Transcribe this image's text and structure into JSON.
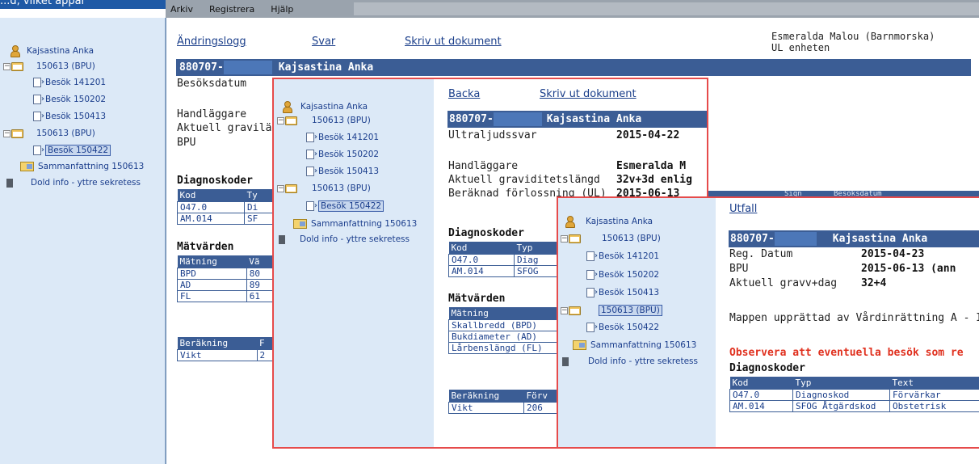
{
  "top_strip_text": "...d, vilket appar",
  "menu": {
    "items": [
      "Arkiv",
      "Registrera",
      "Hjälp"
    ]
  },
  "user": {
    "name": "Esmeralda Malou (Barnmorska)",
    "unit": "UL enheten"
  },
  "tree": {
    "patient": "Kajsastina Anka",
    "folder1": "150613 (BPU)",
    "visits1": [
      "Besök 141201",
      "Besök 150202",
      "Besök 150413"
    ],
    "folder2": "150613 (BPU)",
    "visit_selected": "Besök 150422",
    "summary": "Sammanfattning 150613",
    "hidden": "Dold info - yttre sekretess"
  },
  "base": {
    "links": [
      "Ändringslogg",
      "Svar",
      "Skriv ut dokument"
    ],
    "header_id": "880707-",
    "header_name": "Kajsastina Anka",
    "besoksdatum": "Besöksdatum",
    "handlaggare": "Handläggare",
    "aktuell": "Aktuell graviläng",
    "bpu": "BPU",
    "diag_title": "Diagnoskoder",
    "diag_headers": [
      "Kod",
      "Ty"
    ],
    "diag_rows": [
      [
        "O47.0",
        "Di"
      ],
      [
        "AM.014",
        "SF"
      ]
    ],
    "mat_title": "Mätvärden",
    "mat_headers": [
      "Mätning",
      "Vä"
    ],
    "mat_rows": [
      [
        "BPD",
        "80"
      ],
      [
        "AD",
        "89"
      ],
      [
        "FL",
        "61"
      ]
    ],
    "ber_headers": [
      "Beräkning",
      "F"
    ],
    "ber_rows": [
      [
        "Vikt",
        "2"
      ]
    ]
  },
  "panel1": {
    "links": [
      "Backa",
      "Skriv ut dokument"
    ],
    "header_id": "880707-",
    "header_name": "Kajsastina Anka",
    "ultraljud_label": "Ultraljudssvar",
    "ultraljud_value": "2015-04-22",
    "handlaggare_label": "Handläggare",
    "handlaggare_value": "Esmeralda M",
    "grav_label": "Aktuell graviditetslängd",
    "grav_value": "32v+3d enlig",
    "forloss_label": "Beräknad förlossning (UL)",
    "forloss_value": "2015-06-13",
    "diag_title": "Diagnoskoder",
    "diag_headers": [
      "Kod",
      "Typ"
    ],
    "diag_rows": [
      [
        "O47.0",
        "Diag"
      ],
      [
        "AM.014",
        "SFOG"
      ]
    ],
    "mat_title": "Mätvärden",
    "mat_headers": [
      "Mätning"
    ],
    "mat_rows": [
      [
        "Skallbredd (BPD)"
      ],
      [
        "Bukdiameter (AD)"
      ],
      [
        "Lårbenslängd (FL)"
      ]
    ],
    "ber_headers": [
      "Beräkning",
      "Förv"
    ],
    "ber_rows": [
      [
        "Vikt",
        "206"
      ]
    ],
    "hidden_col_headers": [
      "Sign",
      "Besöksdatum"
    ]
  },
  "panel2": {
    "link": "Utfall",
    "header_id": "880707-",
    "header_name": "Kajsastina Anka",
    "reg_label": "Reg. Datum",
    "reg_value": "2015-04-23",
    "bpu_label": "BPU",
    "bpu_value": "2015-06-13 (ann",
    "grav_label": "Aktuell gravv+dag",
    "grav_value": "32+4",
    "mappen": "Mappen upprättad av Vårdinrättning A - I",
    "warning": "Observera att eventuella besök som re",
    "diag_title": "Diagnoskoder",
    "diag_headers": [
      "Kod",
      "Typ",
      "Text"
    ],
    "diag_rows": [
      [
        "O47.0",
        "Diagnoskod",
        "Förvärkar"
      ],
      [
        "AM.014",
        "SFOG Åtgärdskod",
        "Obstetrisk"
      ]
    ],
    "tree_folder2_selected": "150613 (BPU)"
  },
  "colors": {
    "accent": "#3b5d95",
    "highlight_border": "#e64b4b",
    "tree_bg": "#dce9f7",
    "warning": "#e0301e"
  }
}
